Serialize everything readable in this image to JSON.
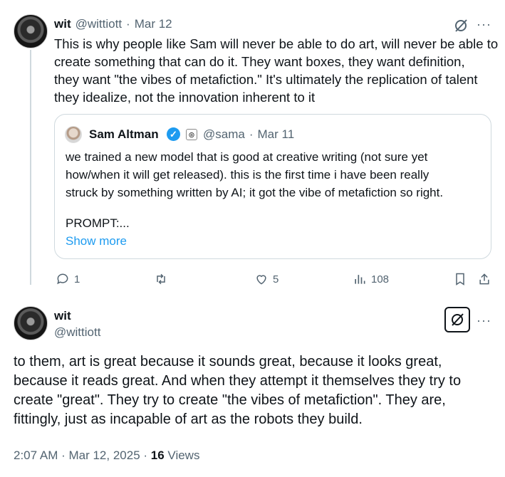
{
  "tweet1": {
    "name": "wit",
    "handle": "@wittiott",
    "sep": "·",
    "date": "Mar 12",
    "text_lines": [
      "This is why people like Sam will never be able to do art, will never be able to",
      "create something that can do it. They want boxes, they want definition,",
      "they want \"the vibes of metafiction.\" It's ultimately the replication of talent",
      "they idealize, not the innovation inherent to it"
    ],
    "quote": {
      "name": "Sam Altman",
      "handle": "@sama",
      "sep": "·",
      "date": "Mar 11",
      "text_lines": [
        "we trained a new model that is good at creative writing (not sure yet",
        "how/when it will get released). this is the first time i have been really",
        "struck by something written by AI; it got the vibe of metafiction so right."
      ],
      "prompt_line": "PROMPT:...",
      "show_more": "Show more"
    },
    "actions": {
      "replies": "1",
      "retweets": "",
      "likes": "5",
      "views": "108"
    }
  },
  "tweet2": {
    "name": "wit",
    "handle": "@wittiott",
    "text_lines": [
      "to them, art is great because it sounds great, because it looks great,",
      "because it reads great. And when they attempt it themselves they try to",
      "create \"great\". They try to create \"the vibes of metafiction\".   They are,",
      "fittingly, just as incapable of art as the robots they build."
    ],
    "timestamp": "2:07 AM · Mar 12, 2025 · ",
    "views_count": "16",
    "views_label": " Views"
  },
  "colors": {
    "text": "#0f1419",
    "muted": "#536471",
    "link": "#1d9bf0",
    "border": "#cfd9de"
  }
}
